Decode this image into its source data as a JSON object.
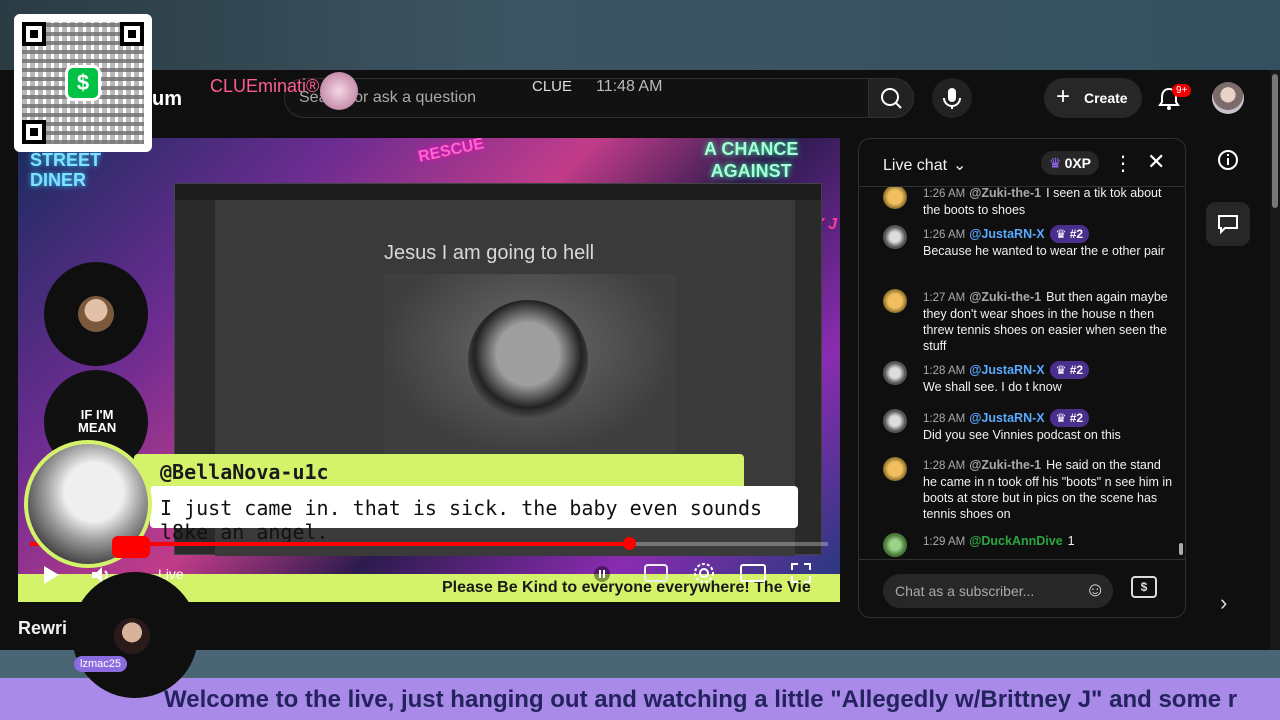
{
  "header": {
    "logo_partial": "um",
    "search_placeholder": "Search or ask a question",
    "create_label": "Create",
    "notifications_badge": "9+"
  },
  "qr": {
    "cash_symbol": "$"
  },
  "video": {
    "neon_street": "STREET\nDINER",
    "neon_chance": "A CHANCE\nAGAINST",
    "neon_rescue": "RESCUE",
    "brand_overlay": "BRITTNEY J",
    "side_text": "IF I'M\nMEAN",
    "inner_msg": {
      "name": "CLUEminati®",
      "tag": "CLUE",
      "time": "11:48 AM",
      "text": "Jesus I am going to hell"
    },
    "highlight": {
      "user": "@BellaNova-u1c",
      "message": "I just came in. that is sick. the baby even sounds l8ke an angel."
    },
    "ticker": "Please Be Kind to everyone everywhere! The Vie",
    "live_label": "Live",
    "progress": 0.75,
    "video_title_partial": "Rewri"
  },
  "guest": {
    "label": "lzmac25"
  },
  "chat": {
    "title": "Live chat",
    "xp": "0XP",
    "input_placeholder": "Chat as a subscriber...",
    "messages": [
      {
        "time": "1:26 AM",
        "user": "@Zuki-the-1",
        "rank": "",
        "text": "I seen a tik tok about the boots to shoes",
        "avatar": "lion"
      },
      {
        "time": "1:26 AM",
        "user": "@JustaRN-X",
        "rank": "#2",
        "text": "Because he wanted to wear the e other pair",
        "avatar": "crow"
      },
      {
        "time": "1:27 AM",
        "user": "@Zuki-the-1",
        "rank": "",
        "text": "But then again maybe they don't wear shoes in the house n then threw tennis shoes on easier when seen the stuff",
        "avatar": "lion"
      },
      {
        "time": "1:28 AM",
        "user": "@JustaRN-X",
        "rank": "#2",
        "text": "We shall see. I do t know",
        "avatar": "crow"
      },
      {
        "time": "1:28 AM",
        "user": "@JustaRN-X",
        "rank": "#2",
        "text": "Did you see Vinnies podcast on this",
        "avatar": "crow"
      },
      {
        "time": "1:28 AM",
        "user": "@Zuki-the-1",
        "rank": "",
        "text": "He said on the stand he came in n took off his \"boots\" n see him in boots at store but in pics on the scene has tennis shoes on",
        "avatar": "lion"
      },
      {
        "time": "1:29 AM",
        "user": "@DuckAnnDive",
        "rank": "",
        "text": "1",
        "avatar": "duck"
      }
    ]
  },
  "banner": {
    "text": "Welcome to the live, just hanging out and watching a little \"Allegedly w/Brittney J\" and some r"
  },
  "colors": {
    "accent_green": "#d4f36a",
    "banner_purple": "#a98ae8",
    "rank_purple": "#4a2f8f",
    "live_red": "#ff0000"
  }
}
